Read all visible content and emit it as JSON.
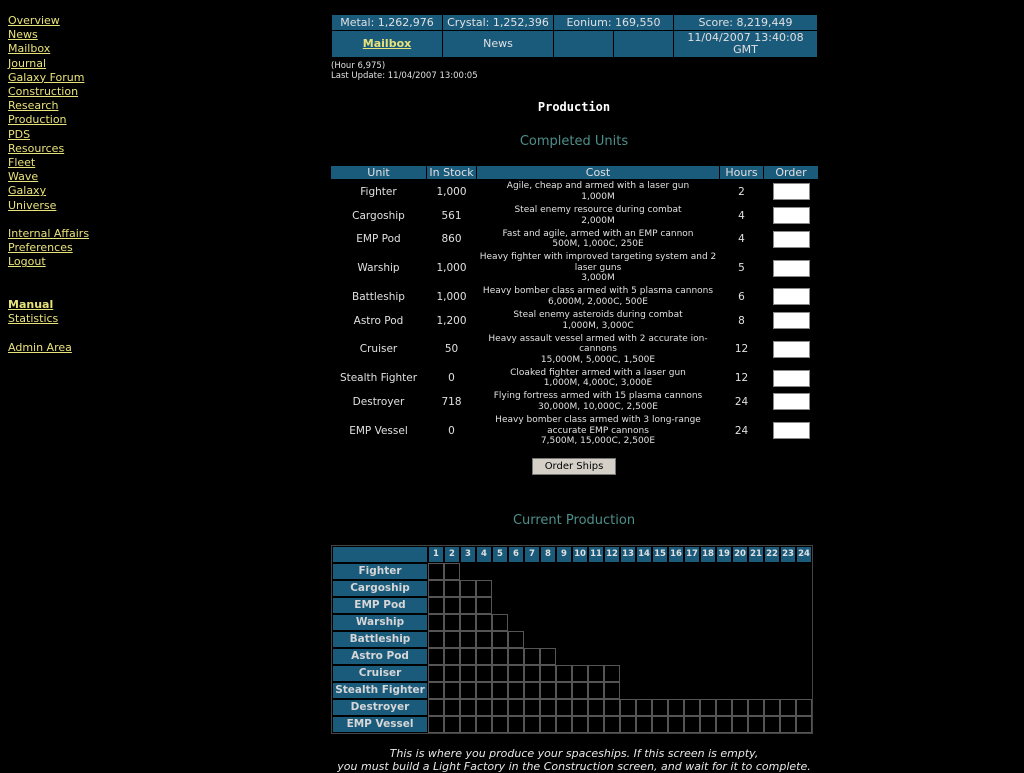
{
  "nav": {
    "items": [
      "Overview",
      "News",
      "Mailbox",
      "Journal",
      "Galaxy Forum",
      "Construction",
      "Research",
      "Production",
      "PDS",
      "Resources",
      "Fleet",
      "Wave",
      "Galaxy",
      "Universe"
    ],
    "items2": [
      "Internal Affairs",
      "Preferences",
      "Logout"
    ],
    "manual": "Manual",
    "statistics": "Statistics",
    "admin": "Admin Area"
  },
  "header": {
    "metal": "Metal: 1,262,976",
    "crystal": "Crystal: 1,252,396",
    "eonium": "Eonium: 169,550",
    "score": "Score: 8,219,449",
    "mailbox": "Mailbox",
    "news": "News",
    "datetime": "11/04/2007 13:40:08 GMT"
  },
  "hour": "(Hour 6,975)",
  "last_update": "Last Update: 11/04/2007 13:00:05",
  "page_title": "Production",
  "completed_title": "Completed Units",
  "columns": {
    "unit": "Unit",
    "stock": "In Stock",
    "cost": "Cost",
    "hours": "Hours",
    "order": "Order"
  },
  "units": [
    {
      "name": "Fighter",
      "stock": "1,000",
      "desc": "Agile, cheap and armed with a laser gun",
      "price": "1,000M",
      "hours": 2
    },
    {
      "name": "Cargoship",
      "stock": "561",
      "desc": "Steal enemy resource during combat",
      "price": "2,000M",
      "hours": 4
    },
    {
      "name": "EMP Pod",
      "stock": "860",
      "desc": "Fast and agile, armed with an EMP cannon",
      "price": "500M, 1,000C, 250E",
      "hours": 4
    },
    {
      "name": "Warship",
      "stock": "1,000",
      "desc": "Heavy fighter with improved targeting system and 2 laser guns",
      "price": "3,000M",
      "hours": 5
    },
    {
      "name": "Battleship",
      "stock": "1,000",
      "desc": "Heavy bomber class armed with 5 plasma cannons",
      "price": "6,000M, 2,000C, 500E",
      "hours": 6
    },
    {
      "name": "Astro Pod",
      "stock": "1,200",
      "desc": "Steal enemy asteroids during combat",
      "price": "1,000M, 3,000C",
      "hours": 8
    },
    {
      "name": "Cruiser",
      "stock": "50",
      "desc": "Heavy assault vessel armed with 2 accurate ion-cannons",
      "price": "15,000M, 5,000C, 1,500E",
      "hours": 12
    },
    {
      "name": "Stealth Fighter",
      "stock": "0",
      "desc": "Cloaked fighter armed with a laser gun",
      "price": "1,000M, 4,000C, 3,000E",
      "hours": 12
    },
    {
      "name": "Destroyer",
      "stock": "718",
      "desc": "Flying fortress armed with 15 plasma cannons",
      "price": "30,000M, 10,000C, 2,500E",
      "hours": 24
    },
    {
      "name": "EMP Vessel",
      "stock": "0",
      "desc": "Heavy bomber class armed with 3 long-range accurate EMP cannons",
      "price": "7,500M, 15,000C, 2,500E",
      "hours": 24
    }
  ],
  "order_button": "Order Ships",
  "current_title": "Current Production",
  "grid_hours": 24,
  "help_text": [
    "This is where you produce your spaceships. If this screen is empty,",
    "you must build a Light Factory in the Construction screen, and wait for it to complete."
  ]
}
